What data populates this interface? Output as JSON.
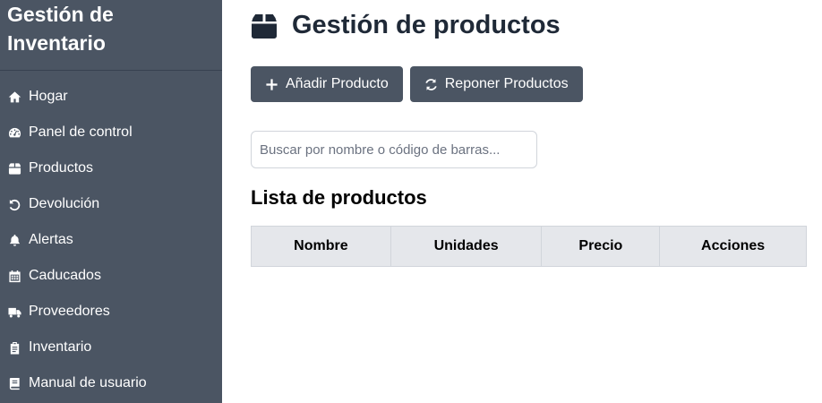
{
  "sidebar": {
    "title": "Gestión de Inventario",
    "items": [
      {
        "label": "Hogar",
        "icon": "home-icon"
      },
      {
        "label": "Panel de control",
        "icon": "dashboard-icon"
      },
      {
        "label": "Productos",
        "icon": "box-icon"
      },
      {
        "label": "Devolución",
        "icon": "undo-icon"
      },
      {
        "label": "Alertas",
        "icon": "bell-icon"
      },
      {
        "label": "Caducados",
        "icon": "calendar-icon"
      },
      {
        "label": "Proveedores",
        "icon": "truck-icon"
      },
      {
        "label": "Inventario",
        "icon": "clipboard-icon"
      },
      {
        "label": "Manual de usuario",
        "icon": "book-icon"
      }
    ]
  },
  "main": {
    "title": "Gestión de productos",
    "title_icon": "box-icon",
    "buttons": {
      "add_label": "Añadir Producto",
      "restock_label": "Reponer Productos"
    },
    "search": {
      "placeholder": "Buscar por nombre o código de barras...",
      "value": ""
    },
    "list_title": "Lista de productos",
    "table": {
      "columns": [
        "Nombre",
        "Unidades",
        "Precio",
        "Acciones"
      ],
      "rows": []
    }
  },
  "colors": {
    "sidebar_bg": "#4b5563",
    "button_bg": "#4b5563",
    "table_header_bg": "#e5e7eb"
  }
}
